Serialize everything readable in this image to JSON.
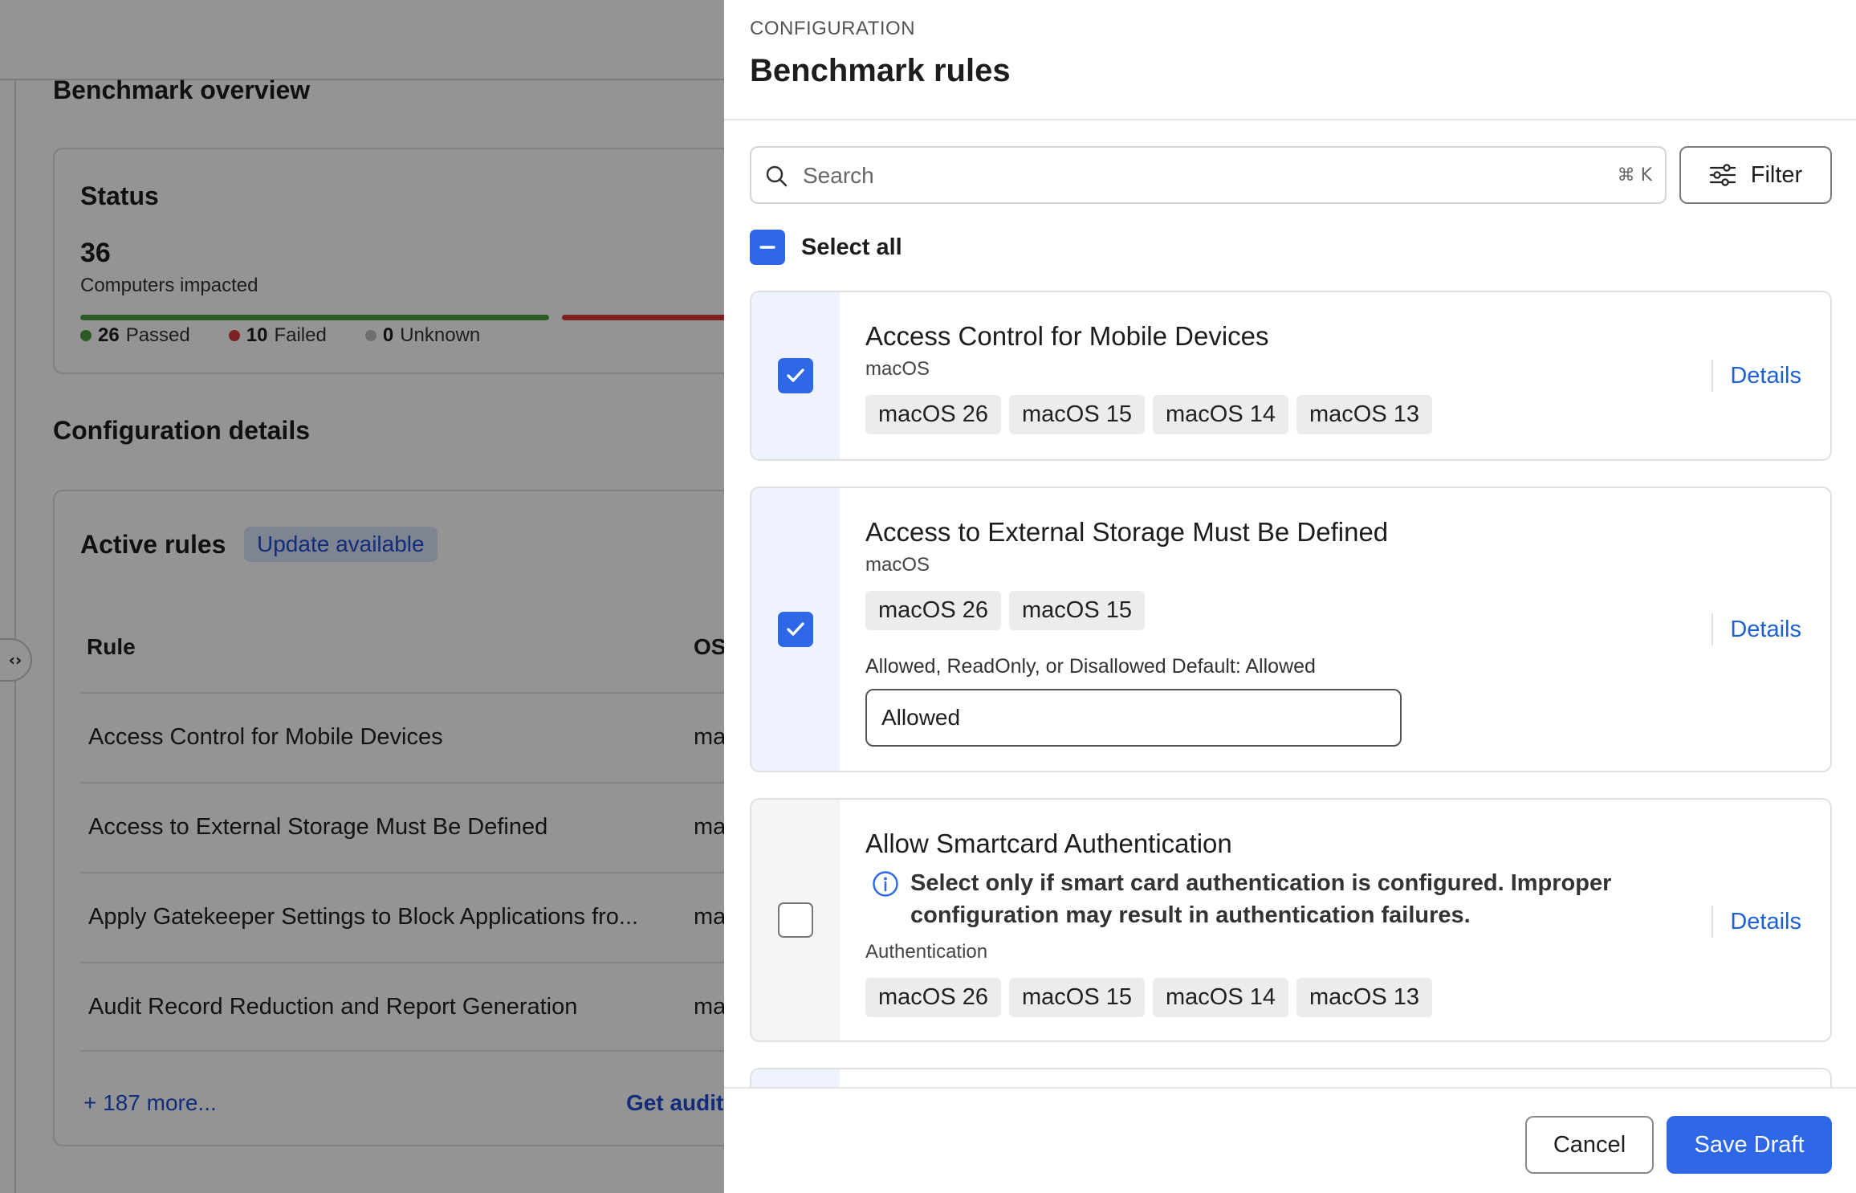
{
  "background": {
    "section_overview": "Benchmark overview",
    "status": {
      "title": "Status",
      "count": "36",
      "count_label": "Computers impacted",
      "passed_count": "26",
      "passed_label": "Passed",
      "failed_count": "10",
      "failed_label": "Failed",
      "unknown_count": "0",
      "unknown_label": "Unknown",
      "passed_fraction": 0.72,
      "failed_fraction": 0.28,
      "colors": {
        "passed": "#4a9d3b",
        "failed": "#d8393b",
        "unknown": "#bdbdbd"
      }
    },
    "section_config": "Configuration details",
    "active_rules": {
      "title": "Active rules",
      "badge": "Update available",
      "col_rule": "Rule",
      "col_os": "OS",
      "rows": [
        {
          "name": "Access Control for Mobile Devices",
          "os": "ma"
        },
        {
          "name": "Access to External Storage Must Be Defined",
          "os": "ma"
        },
        {
          "name": "Apply Gatekeeper Settings to Block Applications fro...",
          "os": "ma"
        },
        {
          "name": "Audit Record Reduction and Report Generation",
          "os": "ma"
        }
      ],
      "more": "+ 187 more...",
      "audit_link": "Get audit"
    },
    "handle_glyph": "‹›"
  },
  "drawer": {
    "eyebrow": "CONFIGURATION",
    "title": "Benchmark rules",
    "search": {
      "placeholder": "Search",
      "shortcut": "⌘ K"
    },
    "filter_label": "Filter",
    "select_all_label": "Select all",
    "details_label": "Details",
    "rules": [
      {
        "name": "Access Control for Mobile Devices",
        "category": "macOS",
        "checked": true,
        "tags": [
          "macOS 26",
          "macOS 15",
          "macOS 14",
          "macOS 13"
        ]
      },
      {
        "name": "Access to External Storage Must Be Defined",
        "category": "macOS",
        "checked": true,
        "tags": [
          "macOS 26",
          "macOS 15"
        ],
        "param_label": "Allowed, ReadOnly, or Disallowed Default: Allowed",
        "param_value": "Allowed"
      },
      {
        "name": "Allow Smartcard Authentication",
        "warning": "Select only if smart card authentication is configured. Improper configuration may result in authentication failures.",
        "category": "Authentication",
        "checked": false,
        "tags": [
          "macOS 26",
          "macOS 15",
          "macOS 14",
          "macOS 13"
        ]
      }
    ],
    "cancel_label": "Cancel",
    "save_label": "Save Draft",
    "accent_color": "#2f68e6"
  }
}
